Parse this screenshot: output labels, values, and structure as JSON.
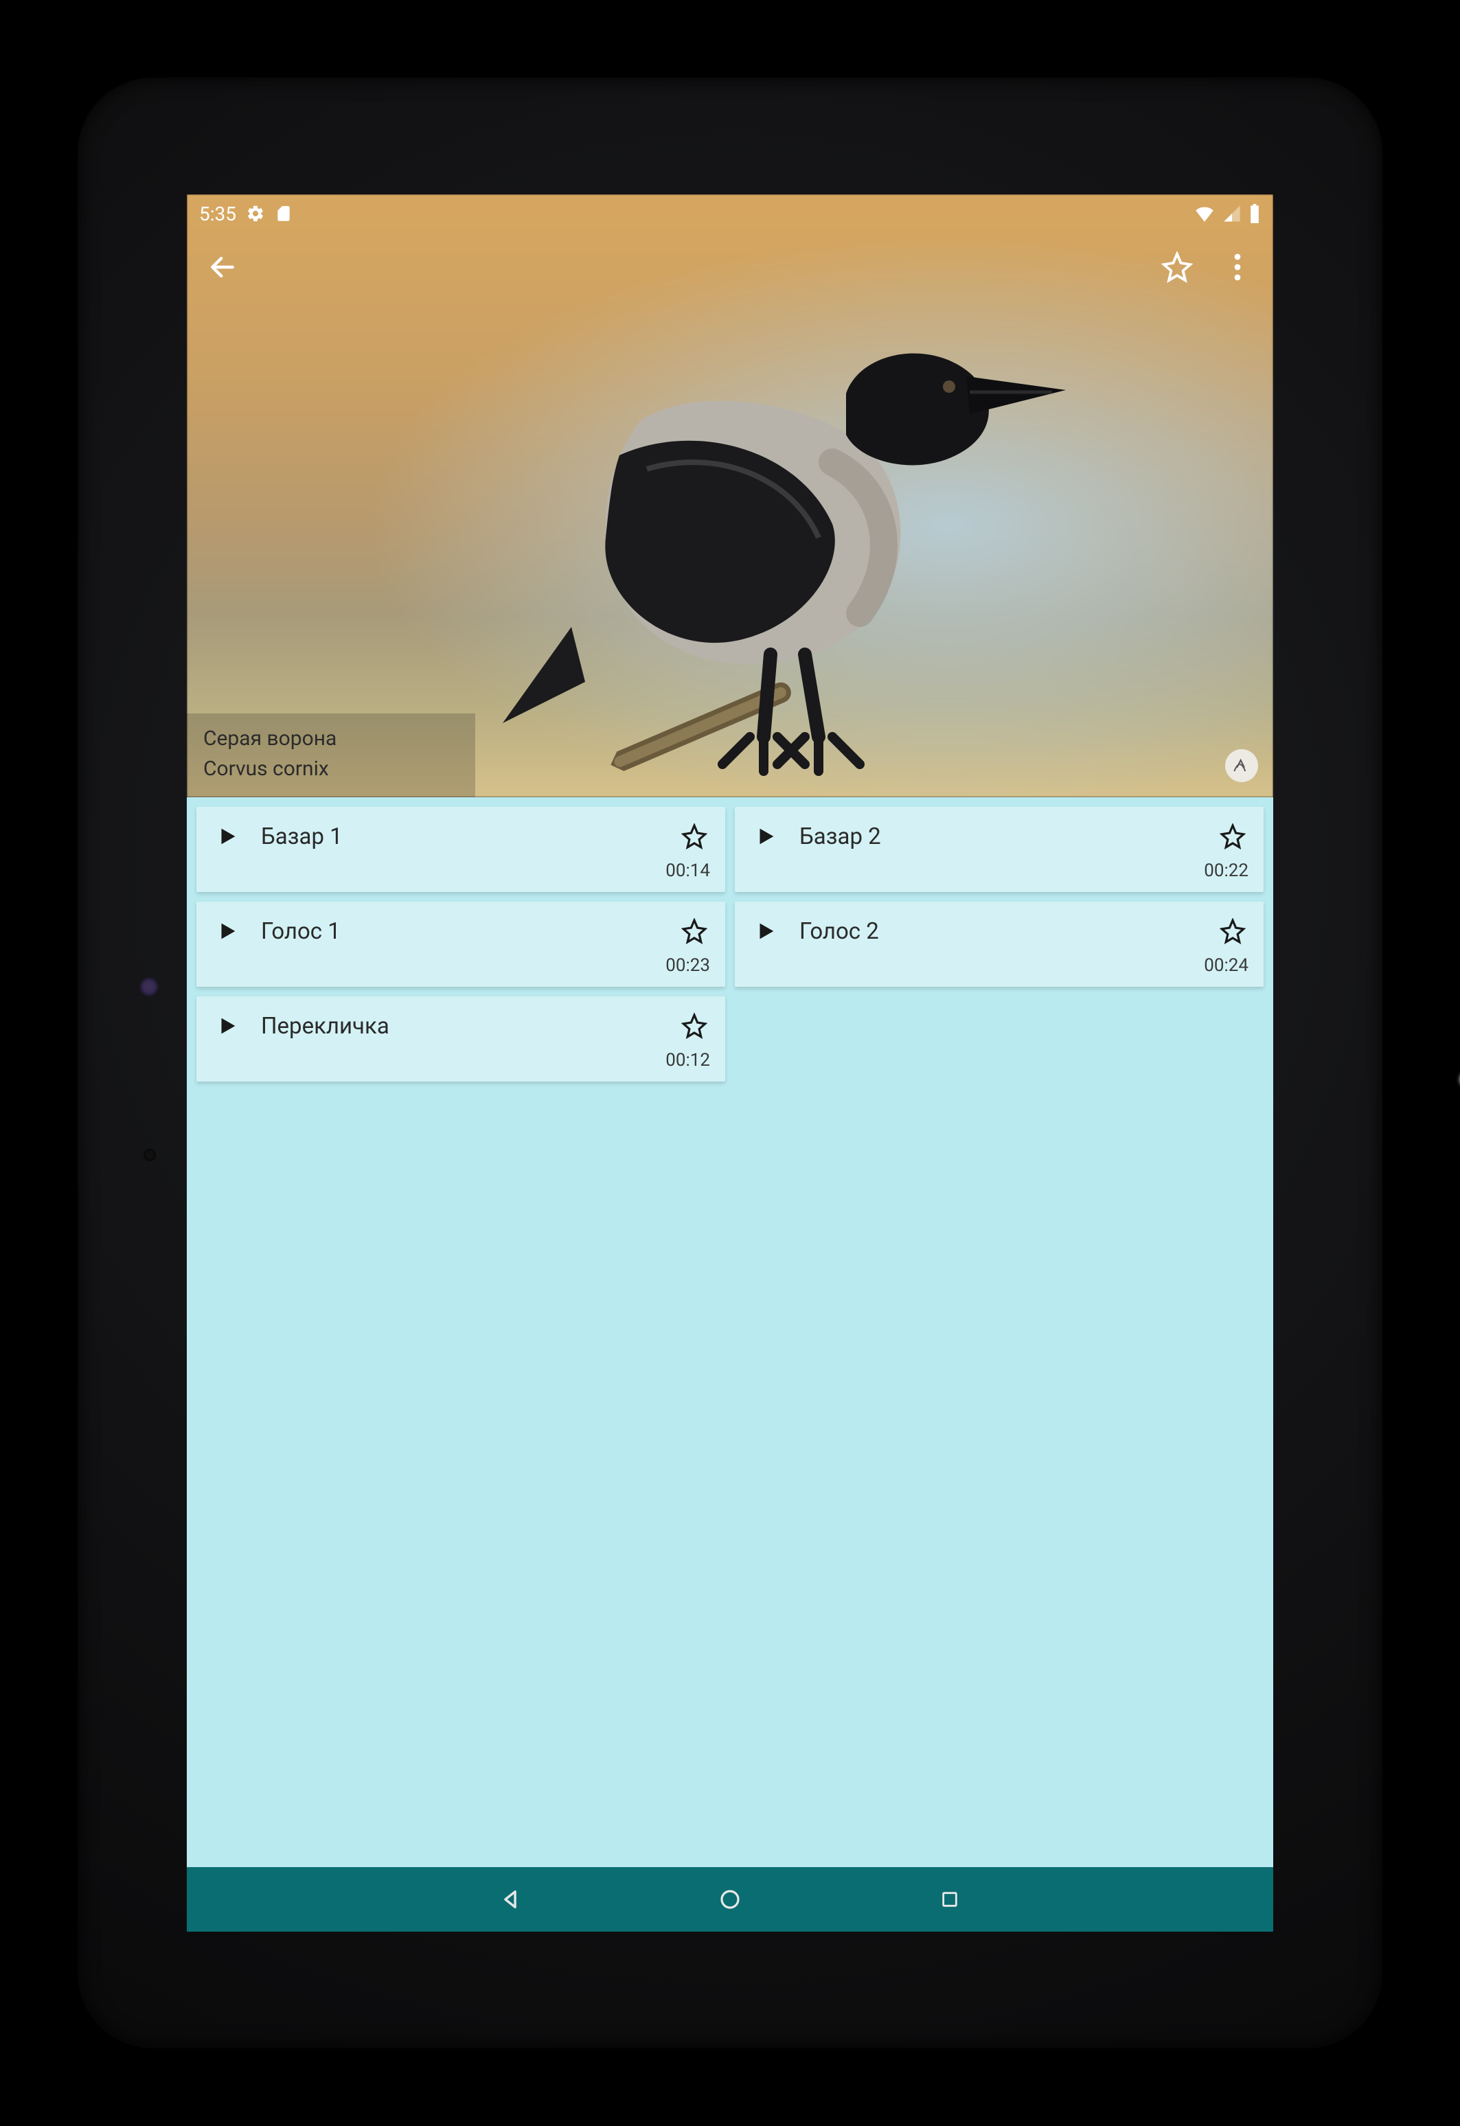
{
  "statusbar": {
    "time": "5:35"
  },
  "bird": {
    "common_name": "Серая ворона",
    "latin_name": "Corvus cornix"
  },
  "clips": [
    {
      "title": "Базар 1",
      "duration": "00:14"
    },
    {
      "title": "Базар 2",
      "duration": "00:22"
    },
    {
      "title": "Голос 1",
      "duration": "00:23"
    },
    {
      "title": "Голос 2",
      "duration": "00:24"
    },
    {
      "title": "Перекличка",
      "duration": "00:12"
    }
  ]
}
